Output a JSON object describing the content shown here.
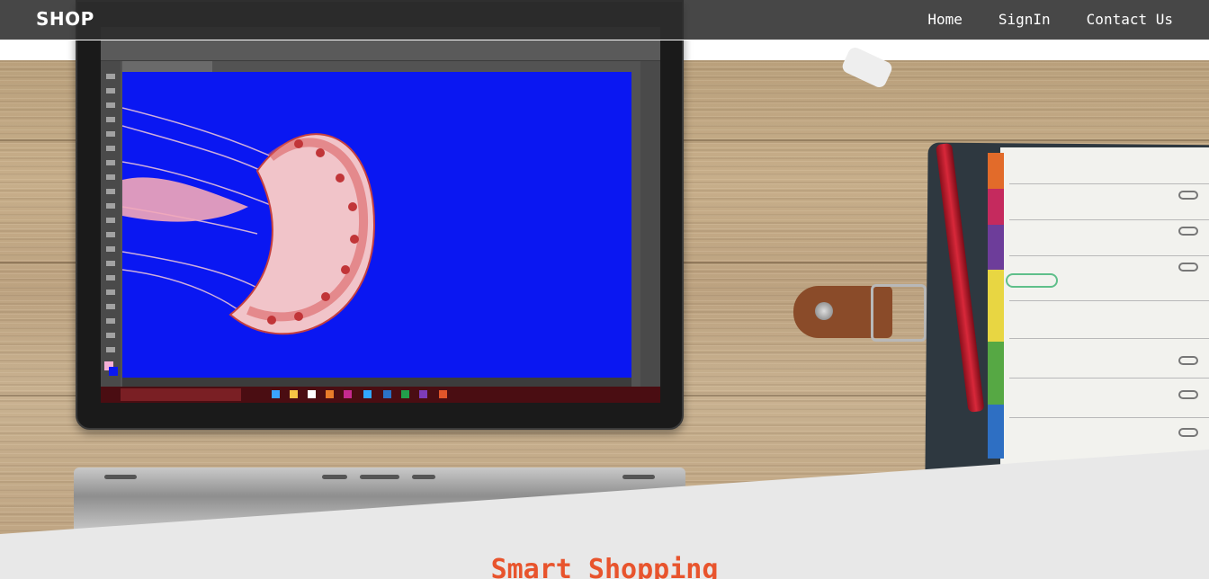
{
  "navbar": {
    "brand": "SHOP",
    "links": [
      {
        "label": "Home"
      },
      {
        "label": "SignIn"
      },
      {
        "label": "Contact Us"
      }
    ]
  },
  "hero": {
    "image_description": "laptop-with-photo-editor-on-wooden-desk"
  },
  "section": {
    "title": "Smart Shopping"
  },
  "colors": {
    "navbar_bg": "#2d2d2d",
    "accent": "#e8542d",
    "section_bg": "#e8e8e8",
    "canvas_blue": "#0a17f2"
  }
}
